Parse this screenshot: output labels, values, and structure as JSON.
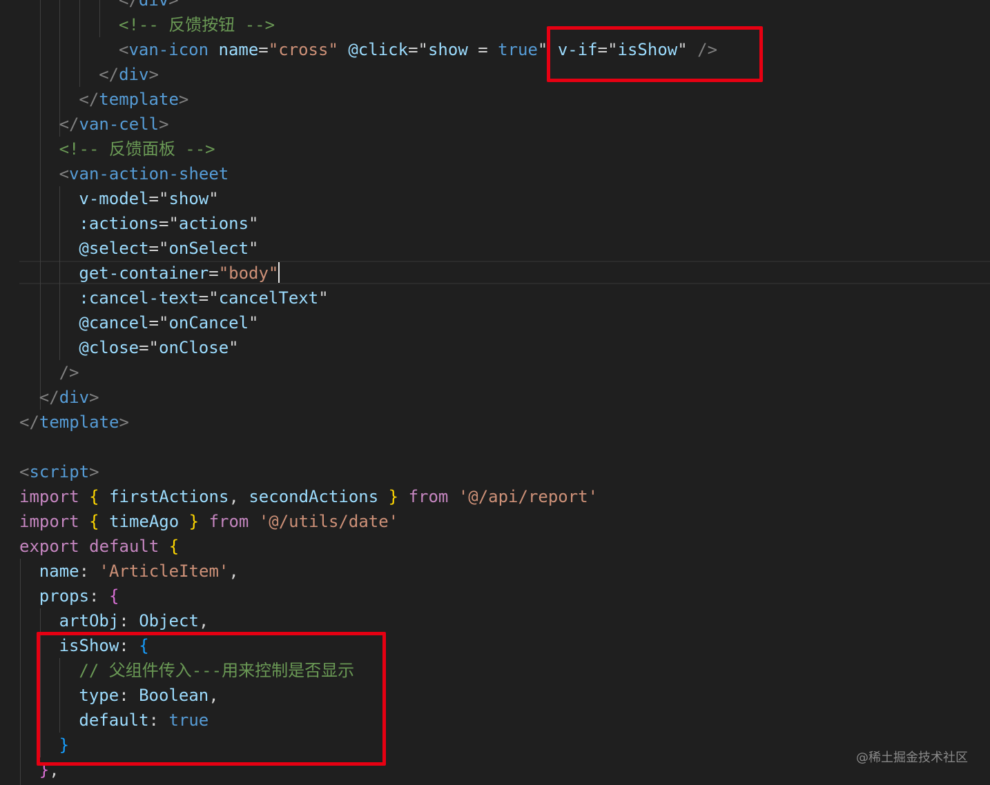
{
  "editor": {
    "lines": [
      {
        "tokens": [
          [
            "</",
            "punc"
          ],
          [
            "div",
            "tag"
          ],
          [
            ">",
            "punc"
          ]
        ]
      },
      {
        "tokens": [
          [
            "<!-- 反馈按钮 -->",
            "comment"
          ]
        ]
      },
      {
        "tokens": [
          [
            "<",
            "punc"
          ],
          [
            "van-icon",
            "tag"
          ],
          [
            " ",
            "text"
          ],
          [
            "name",
            "attr"
          ],
          [
            "=",
            "text"
          ],
          [
            "\"cross\"",
            "str"
          ],
          [
            " ",
            "text"
          ],
          [
            "@click",
            "attr"
          ],
          [
            "=",
            "text"
          ],
          [
            "\"",
            "text"
          ],
          [
            "show",
            "attr"
          ],
          [
            " = ",
            "text"
          ],
          [
            "true",
            "bool"
          ],
          [
            "\"",
            "text"
          ],
          [
            " ",
            "text"
          ],
          [
            "v-if",
            "attr"
          ],
          [
            "=",
            "text"
          ],
          [
            "\"",
            "text"
          ],
          [
            "isShow",
            "attr"
          ],
          [
            "\"",
            "text"
          ],
          [
            " />",
            "punc"
          ]
        ]
      },
      {
        "tokens": [
          [
            "</",
            "punc"
          ],
          [
            "div",
            "tag"
          ],
          [
            ">",
            "punc"
          ]
        ]
      },
      {
        "tokens": [
          [
            "</",
            "punc"
          ],
          [
            "template",
            "tag"
          ],
          [
            ">",
            "punc"
          ]
        ]
      },
      {
        "tokens": [
          [
            "</",
            "punc"
          ],
          [
            "van-cell",
            "tag"
          ],
          [
            ">",
            "punc"
          ]
        ]
      },
      {
        "tokens": [
          [
            "<!-- 反馈面板 -->",
            "comment"
          ]
        ]
      },
      {
        "tokens": [
          [
            "<",
            "punc"
          ],
          [
            "van-action-sheet",
            "tag"
          ]
        ]
      },
      {
        "tokens": [
          [
            "v-model",
            "attr"
          ],
          [
            "=",
            "text"
          ],
          [
            "\"",
            "text"
          ],
          [
            "show",
            "attr"
          ],
          [
            "\"",
            "text"
          ]
        ]
      },
      {
        "tokens": [
          [
            ":actions",
            "attr"
          ],
          [
            "=",
            "text"
          ],
          [
            "\"",
            "text"
          ],
          [
            "actions",
            "attr"
          ],
          [
            "\"",
            "text"
          ]
        ]
      },
      {
        "tokens": [
          [
            "@select",
            "attr"
          ],
          [
            "=",
            "text"
          ],
          [
            "\"",
            "text"
          ],
          [
            "onSelect",
            "attr"
          ],
          [
            "\"",
            "text"
          ]
        ]
      },
      {
        "tokens": [
          [
            "get-container",
            "attr"
          ],
          [
            "=",
            "text"
          ],
          [
            "\"body\"",
            "str"
          ]
        ]
      },
      {
        "tokens": [
          [
            ":cancel-text",
            "attr"
          ],
          [
            "=",
            "text"
          ],
          [
            "\"",
            "text"
          ],
          [
            "cancelText",
            "attr"
          ],
          [
            "\"",
            "text"
          ]
        ]
      },
      {
        "tokens": [
          [
            "@cancel",
            "attr"
          ],
          [
            "=",
            "text"
          ],
          [
            "\"",
            "text"
          ],
          [
            "onCancel",
            "attr"
          ],
          [
            "\"",
            "text"
          ]
        ]
      },
      {
        "tokens": [
          [
            "@close",
            "attr"
          ],
          [
            "=",
            "text"
          ],
          [
            "\"",
            "text"
          ],
          [
            "onClose",
            "attr"
          ],
          [
            "\"",
            "text"
          ]
        ]
      },
      {
        "tokens": [
          [
            "/>",
            "punc"
          ]
        ]
      },
      {
        "tokens": [
          [
            "</",
            "punc"
          ],
          [
            "div",
            "tag"
          ],
          [
            ">",
            "punc"
          ]
        ]
      },
      {
        "tokens": [
          [
            "</",
            "punc"
          ],
          [
            "template",
            "tag"
          ],
          [
            ">",
            "punc"
          ]
        ]
      },
      {
        "tokens": []
      },
      {
        "tokens": [
          [
            "<",
            "punc"
          ],
          [
            "script",
            "tag"
          ],
          [
            ">",
            "punc"
          ]
        ]
      },
      {
        "tokens": [
          [
            "import",
            "kw"
          ],
          [
            " ",
            "text"
          ],
          [
            "{",
            "b1"
          ],
          [
            " ",
            "text"
          ],
          [
            "firstActions",
            "attr"
          ],
          [
            ", ",
            "text"
          ],
          [
            "secondActions",
            "attr"
          ],
          [
            " ",
            "text"
          ],
          [
            "}",
            "b1"
          ],
          [
            " ",
            "text"
          ],
          [
            "from",
            "kw"
          ],
          [
            " ",
            "text"
          ],
          [
            "'@/api/report'",
            "str"
          ]
        ]
      },
      {
        "tokens": [
          [
            "import",
            "kw"
          ],
          [
            " ",
            "text"
          ],
          [
            "{",
            "b1"
          ],
          [
            " ",
            "text"
          ],
          [
            "timeAgo",
            "attr"
          ],
          [
            " ",
            "text"
          ],
          [
            "}",
            "b1"
          ],
          [
            " ",
            "text"
          ],
          [
            "from",
            "kw"
          ],
          [
            " ",
            "text"
          ],
          [
            "'@/utils/date'",
            "str"
          ]
        ]
      },
      {
        "tokens": [
          [
            "export",
            "kw"
          ],
          [
            " ",
            "text"
          ],
          [
            "default",
            "kw"
          ],
          [
            " ",
            "text"
          ],
          [
            "{",
            "b1"
          ]
        ]
      },
      {
        "tokens": [
          [
            "name",
            "attr"
          ],
          [
            ": ",
            "text"
          ],
          [
            "'ArticleItem'",
            "str"
          ],
          [
            ",",
            "text"
          ]
        ]
      },
      {
        "tokens": [
          [
            "props",
            "attr"
          ],
          [
            ": ",
            "text"
          ],
          [
            "{",
            "b2"
          ]
        ]
      },
      {
        "tokens": [
          [
            "artObj",
            "attr"
          ],
          [
            ": ",
            "text"
          ],
          [
            "Object",
            "attr"
          ],
          [
            ",",
            "text"
          ]
        ]
      },
      {
        "tokens": [
          [
            "isShow",
            "attr"
          ],
          [
            ": ",
            "text"
          ],
          [
            "{",
            "b3"
          ]
        ]
      },
      {
        "tokens": [
          [
            "// 父组件传入---用来控制是否显示",
            "comment"
          ]
        ]
      },
      {
        "tokens": [
          [
            "type",
            "attr"
          ],
          [
            ": ",
            "text"
          ],
          [
            "Boolean",
            "attr"
          ],
          [
            ",",
            "text"
          ]
        ]
      },
      {
        "tokens": [
          [
            "default",
            "attr"
          ],
          [
            ": ",
            "text"
          ],
          [
            "true",
            "bool"
          ]
        ]
      },
      {
        "tokens": [
          [
            "}",
            "b3"
          ]
        ]
      },
      {
        "tokens": [
          [
            "}",
            "b2"
          ],
          [
            ",",
            "text"
          ]
        ]
      }
    ]
  },
  "watermark": {
    "text": "@稀土掘金技术社区"
  },
  "colors": {
    "background": "#1f1f1f",
    "highlight_box": "#e60012"
  }
}
